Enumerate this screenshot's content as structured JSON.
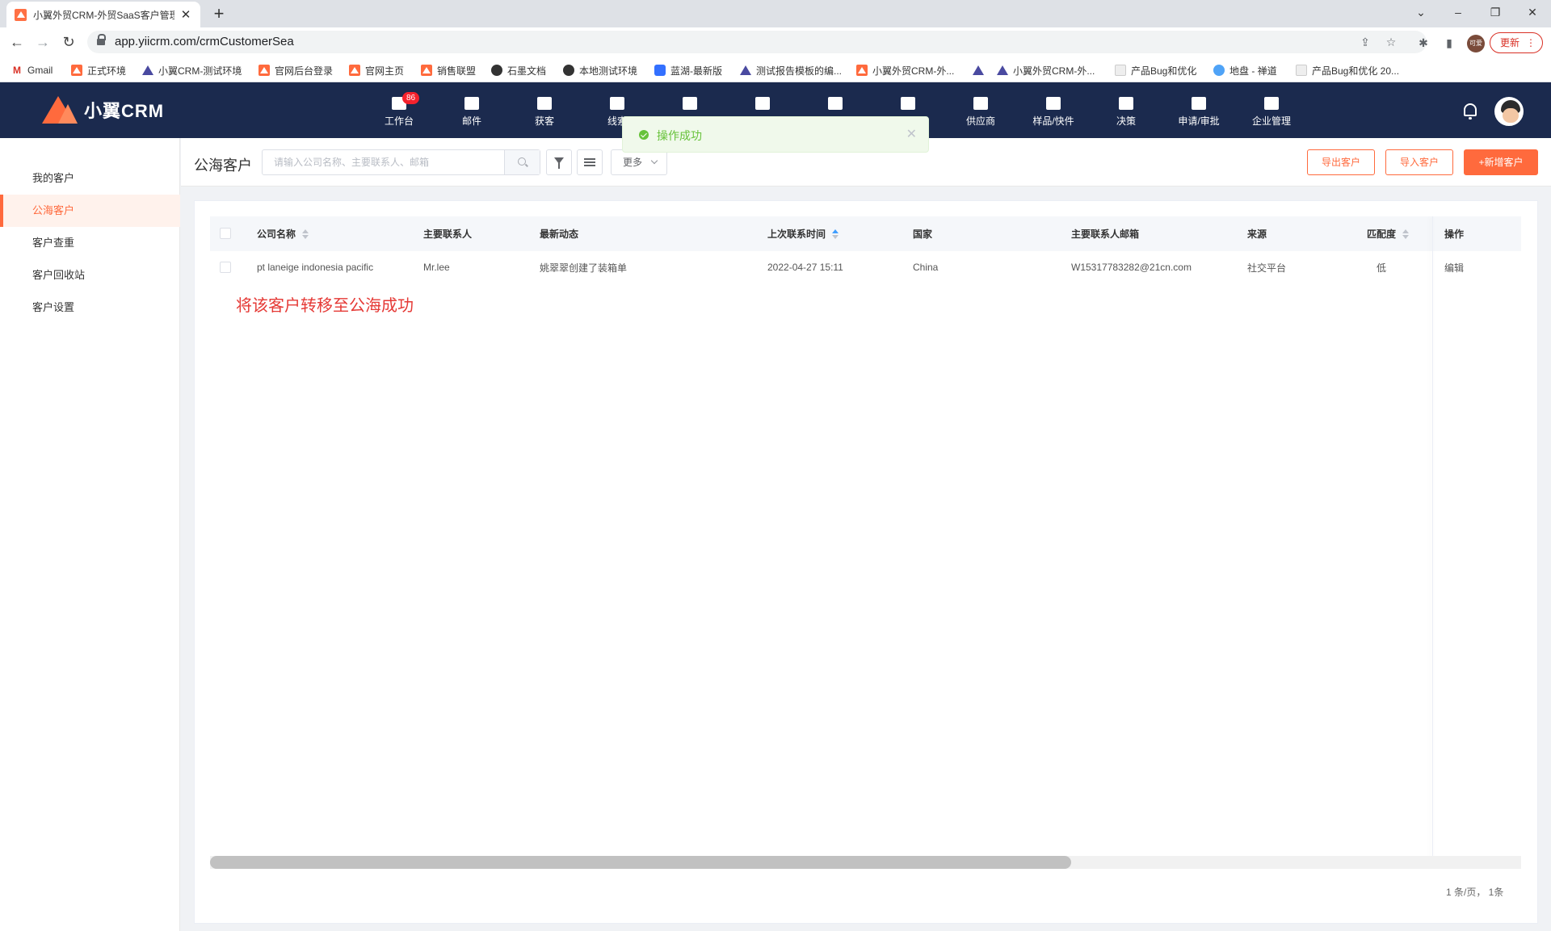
{
  "browser": {
    "tab_title": "小翼外贸CRM-外贸SaaS客户管理",
    "url": "app.yiicrm.com/crmCustomerSea",
    "update_label": "更新",
    "profile_label": "可爱",
    "bookmarks": [
      {
        "label": "Gmail",
        "icon": "gmail"
      },
      {
        "label": "正式环境",
        "icon": "orange"
      },
      {
        "label": "小翼CRM-测试环境",
        "icon": "tri"
      },
      {
        "label": "官网后台登录",
        "icon": "orange"
      },
      {
        "label": "官网主页",
        "icon": "orange"
      },
      {
        "label": "销售联盟",
        "icon": "orange"
      },
      {
        "label": "石墨文档",
        "icon": "circle"
      },
      {
        "label": "本地测试环境",
        "icon": "circle"
      },
      {
        "label": "蓝湖-最新版",
        "icon": "blue"
      },
      {
        "label": "测试报告模板的编...",
        "icon": "tri"
      },
      {
        "label": "小翼外贸CRM-外...",
        "icon": "orange"
      },
      {
        "label": "",
        "icon": "tri"
      },
      {
        "label": "小翼外贸CRM-外...",
        "icon": "tri"
      },
      {
        "label": "产品Bug和优化",
        "icon": "doc"
      },
      {
        "label": "地盘 - 禅道",
        "icon": "dibao"
      },
      {
        "label": "产品Bug和优化 20...",
        "icon": "doc"
      }
    ]
  },
  "app": {
    "logo_text": "小翼CRM",
    "nav": [
      {
        "label": "工作台",
        "badge": "86"
      },
      {
        "label": "邮件"
      },
      {
        "label": "获客"
      },
      {
        "label": "线索"
      },
      {
        "label": ""
      },
      {
        "label": ""
      },
      {
        "label": ""
      },
      {
        "label": ""
      },
      {
        "label": "供应商"
      },
      {
        "label": "样品/快件"
      },
      {
        "label": "决策"
      },
      {
        "label": "申请/审批"
      },
      {
        "label": "企业管理"
      }
    ]
  },
  "toast": {
    "message": "操作成功"
  },
  "sidebar": {
    "items": [
      {
        "label": "我的客户"
      },
      {
        "label": "公海客户",
        "active": true
      },
      {
        "label": "客户查重"
      },
      {
        "label": "客户回收站"
      },
      {
        "label": "客户设置"
      }
    ]
  },
  "page": {
    "title": "公海客户",
    "search_placeholder": "请输入公司名称、主要联系人、邮箱",
    "more_label": "更多",
    "export_label": "导出客户",
    "import_label": "导入客户",
    "add_label": "+新增客户"
  },
  "table": {
    "columns": [
      "公司名称",
      "主要联系人",
      "最新动态",
      "上次联系时间",
      "国家",
      "主要联系人邮箱",
      "来源",
      "匹配度",
      "操作"
    ],
    "rows": [
      {
        "company": "pt laneige indonesia pacific",
        "contact": "Mr.lee",
        "latest": "姚翠翠创建了装箱单",
        "last_contact": "2022-04-27 15:11",
        "country": "China",
        "email": "W15317783282@21cn.com",
        "source": "社交平台",
        "match": "低",
        "action": "编辑"
      }
    ]
  },
  "annotation": "将该客户转移至公海成功",
  "pagination": {
    "text": "1 条/页，  1条"
  },
  "scrollbar": {
    "thumb_fraction": 0.657
  },
  "colors": {
    "accent": "#ff6a3d",
    "header": "#1b2a4e",
    "success": "#67c23a",
    "annotation": "#e53935"
  }
}
